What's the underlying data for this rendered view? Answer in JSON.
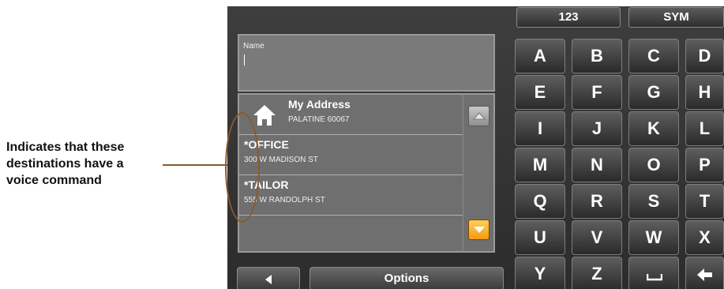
{
  "annotation": {
    "lines": [
      "Indicates that these",
      "destinations have a",
      "voice command"
    ]
  },
  "name_field": {
    "label": "Name"
  },
  "destinations": [
    {
      "title": "My Address",
      "subtitle": "PALATINE 60067",
      "icon": "home-icon"
    },
    {
      "title": "*OFFICE",
      "subtitle": "300 W MADISON ST"
    },
    {
      "title": "*TAILOR",
      "subtitle": "555 W RANDOLPH ST"
    }
  ],
  "bottom": {
    "options_label": "Options"
  },
  "keyboard": {
    "mode_keys": [
      "123",
      "SYM"
    ],
    "rows": [
      [
        "A",
        "B",
        "C",
        "D"
      ],
      [
        "E",
        "F",
        "G",
        "H"
      ],
      [
        "I",
        "J",
        "K",
        "L"
      ],
      [
        "M",
        "N",
        "O",
        "P"
      ],
      [
        "Q",
        "R",
        "S",
        "T"
      ],
      [
        "U",
        "V",
        "W",
        "X"
      ],
      [
        "Y",
        "Z"
      ]
    ]
  },
  "colors": {
    "scroll_down_accent": "#f59a12",
    "annotation_line": "#8a5a2b",
    "panel_bg": "#6f6f6f"
  }
}
